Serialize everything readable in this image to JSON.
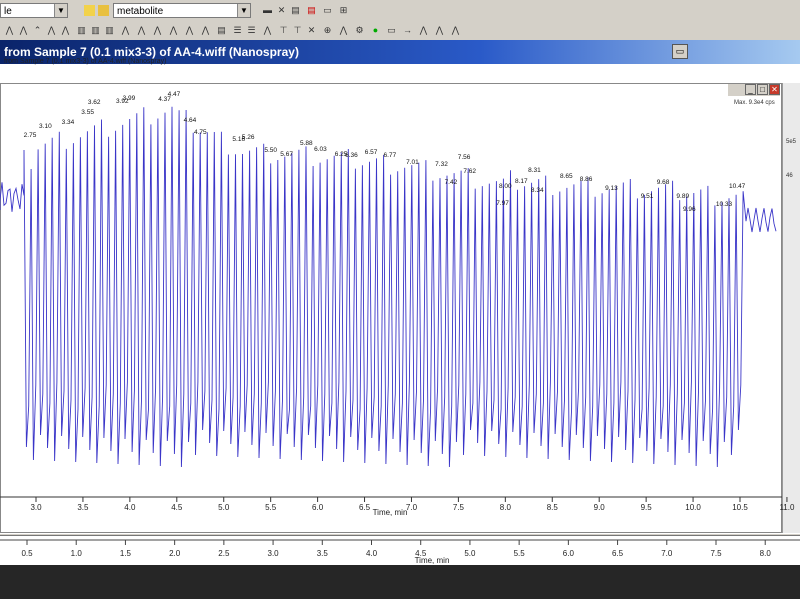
{
  "toolbar": {
    "combo_small_value": "",
    "metabolite_value": "metabolite",
    "left_stub": "le"
  },
  "window": {
    "title": "from Sample 7 (0.1 mix3-3) of AA-4.wiff (Nanospray)",
    "subcaption": "from Sample 7 (0.1 mix3-3) of AA-4.wiff (Nanospray)",
    "max_label": "Max. 9.3e4 cps",
    "right_strip_labels": [
      "5e5",
      "46"
    ]
  },
  "chart_data": {
    "type": "line",
    "title": "",
    "xlabel": "Time, min",
    "ylabel": "",
    "xlim": [
      2.8,
      11.0
    ],
    "x_ticks": [
      "3.0",
      "3.5",
      "4.0",
      "4.5",
      "5.0",
      "5.5",
      "6.0",
      "6.5",
      "7.0",
      "7.5",
      "8.0",
      "8.5",
      "9.0",
      "9.5",
      "10.0",
      "10.5",
      "11.0"
    ],
    "peak_labels": [
      {
        "x": 2.75,
        "label": "2.75"
      },
      {
        "x": 3.1,
        "label": "3.10"
      },
      {
        "x": 3.34,
        "label": "3.34"
      },
      {
        "x": 3.55,
        "label": "3.55"
      },
      {
        "x": 3.62,
        "label": "3.62"
      },
      {
        "x": 3.92,
        "label": "3.92"
      },
      {
        "x": 3.99,
        "label": "3.99"
      },
      {
        "x": 4.37,
        "label": "4.37"
      },
      {
        "x": 4.47,
        "label": "4.47"
      },
      {
        "x": 4.64,
        "label": "4.64"
      },
      {
        "x": 4.75,
        "label": "4.75"
      },
      {
        "x": 5.16,
        "label": "5.16"
      },
      {
        "x": 5.26,
        "label": "5.26"
      },
      {
        "x": 5.5,
        "label": "5.50"
      },
      {
        "x": 5.67,
        "label": "5.67"
      },
      {
        "x": 5.88,
        "label": "5.88"
      },
      {
        "x": 6.03,
        "label": "6.03"
      },
      {
        "x": 6.25,
        "label": "6.25"
      },
      {
        "x": 6.36,
        "label": "6.36"
      },
      {
        "x": 6.57,
        "label": "6.57"
      },
      {
        "x": 6.77,
        "label": "6.77"
      },
      {
        "x": 7.01,
        "label": "7.01"
      },
      {
        "x": 7.32,
        "label": "7.32"
      },
      {
        "x": 7.42,
        "label": "7.42"
      },
      {
        "x": 7.56,
        "label": "7.56"
      },
      {
        "x": 7.62,
        "label": "7.62"
      },
      {
        "x": 7.97,
        "label": "7.97"
      },
      {
        "x": 8.0,
        "label": "8.00"
      },
      {
        "x": 8.17,
        "label": "8.17"
      },
      {
        "x": 8.31,
        "label": "8.31"
      },
      {
        "x": 8.34,
        "label": "8.34"
      },
      {
        "x": 8.65,
        "label": "8.65"
      },
      {
        "x": 8.86,
        "label": "8.86"
      },
      {
        "x": 9.13,
        "label": "9.13"
      },
      {
        "x": 9.51,
        "label": "9.51"
      },
      {
        "x": 9.68,
        "label": "9.68"
      },
      {
        "x": 9.89,
        "label": "9.89"
      },
      {
        "x": 9.96,
        "label": "9.96"
      },
      {
        "x": 10.33,
        "label": "10.33"
      },
      {
        "x": 10.47,
        "label": "10.47"
      }
    ],
    "series_color": "#3a35c8"
  },
  "lower_axis": {
    "xlabel": "Time, min",
    "ticks": [
      "0.5",
      "1.0",
      "1.5",
      "2.0",
      "2.5",
      "3.0",
      "3.5",
      "4.0",
      "4.5",
      "5.0",
      "5.5",
      "6.0",
      "6.5",
      "7.0",
      "7.5",
      "8.0"
    ]
  }
}
